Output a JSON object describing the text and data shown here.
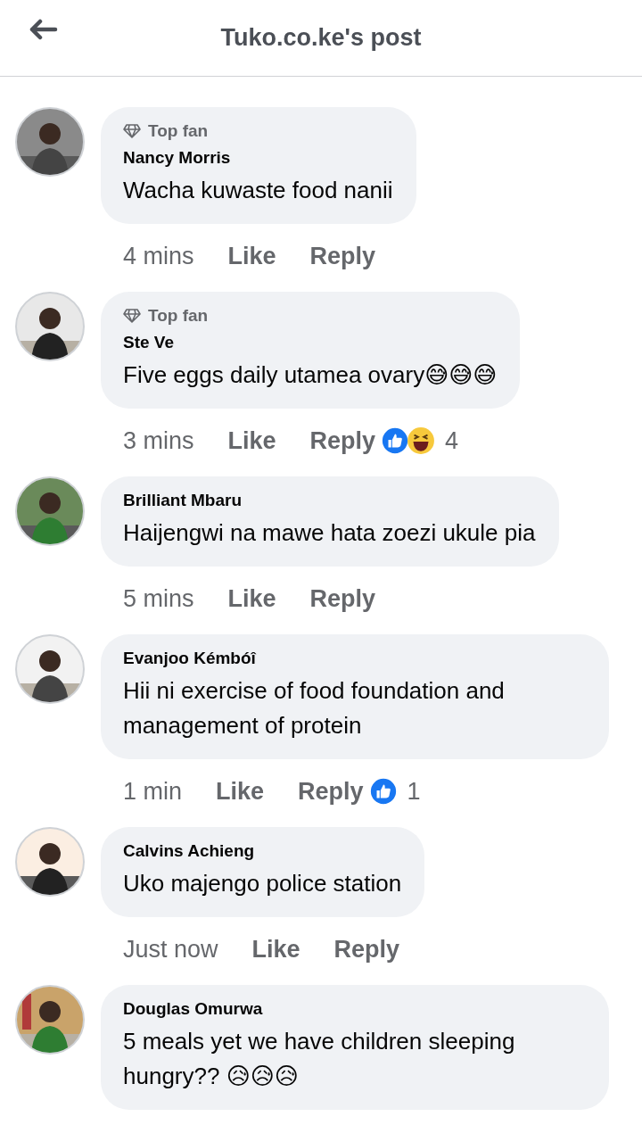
{
  "header": {
    "title": "Tuko.co.ke's post"
  },
  "comments": [
    {
      "badge": "Top fan",
      "name": "Nancy Morris",
      "text": "Wacha kuwaste food nanii",
      "time": "4 mins",
      "like": "Like",
      "reply": "Reply"
    },
    {
      "badge": "Top fan",
      "name": "Ste Ve",
      "text": "Five eggs daily utamea ovary😅😅😅",
      "time": "3 mins",
      "like": "Like",
      "reply": "Reply",
      "reactions": [
        {
          "kind": "like"
        },
        {
          "kind": "haha"
        }
      ],
      "reaction_count": "4"
    },
    {
      "name": "Brilliant Mbaru",
      "text": "Haijengwi na mawe hata zoezi ukule pia",
      "time": "5 mins",
      "like": "Like",
      "reply": "Reply"
    },
    {
      "name": "Evanjoo Kémbóî",
      "text": "Hii ni exercise of food foundation and management of protein",
      "time": "1 min",
      "like": "Like",
      "reply": "Reply",
      "reactions": [
        {
          "kind": "like"
        }
      ],
      "reaction_count": "1"
    },
    {
      "name": "Calvins Achieng",
      "text": "Uko majengo police station",
      "time": "Just now",
      "like": "Like",
      "reply": "Reply"
    },
    {
      "name": "Douglas Omurwa",
      "text": "5 meals yet we have children sleeping hungry?? 😥😥😥"
    }
  ]
}
